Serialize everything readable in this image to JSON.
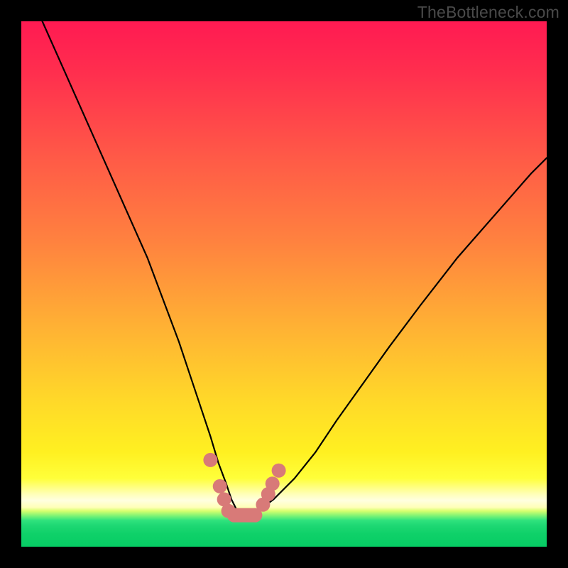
{
  "watermark": "TheBottleneck.com",
  "colors": {
    "gradient_top": "#ff1a52",
    "gradient_mid": "#ffd829",
    "gradient_band": "#ffffe0",
    "gradient_green": "#06cc64",
    "curve": "#000000",
    "markers": "#d87a78",
    "frame": "#000000"
  },
  "chart_data": {
    "type": "line",
    "title": "",
    "xlabel": "",
    "ylabel": "",
    "xlim": [
      0,
      100
    ],
    "ylim": [
      0,
      100
    ],
    "legend": false,
    "grid": false,
    "series": [
      {
        "name": "bottleneck-curve",
        "x": [
          4,
          8,
          12,
          16,
          20,
          24,
          27,
          30,
          32,
          34,
          36,
          37.5,
          39,
          40,
          41,
          42,
          43,
          44,
          46,
          48,
          52,
          56,
          60,
          65,
          70,
          76,
          83,
          90,
          97,
          100
        ],
        "y": [
          100,
          91,
          82,
          73,
          64,
          55,
          47,
          39,
          33,
          27,
          21,
          16,
          12,
          9,
          7,
          6,
          6,
          6.5,
          7.5,
          9,
          13,
          18,
          24,
          31,
          38,
          46,
          55,
          63,
          71,
          74
        ]
      }
    ],
    "markers": {
      "name": "highlighted-points",
      "note": "pink dots near the valley of the curve",
      "points": [
        {
          "x": 36.0,
          "y": 16.5
        },
        {
          "x": 37.8,
          "y": 11.5
        },
        {
          "x": 38.6,
          "y": 9.0
        },
        {
          "x": 39.4,
          "y": 6.8
        },
        {
          "x": 40.5,
          "y": 6.0
        },
        {
          "x": 41.5,
          "y": 6.0
        },
        {
          "x": 42.5,
          "y": 6.0
        },
        {
          "x": 43.5,
          "y": 6.0
        },
        {
          "x": 44.5,
          "y": 6.0
        },
        {
          "x": 46.0,
          "y": 8.0
        },
        {
          "x": 47.0,
          "y": 10.0
        },
        {
          "x": 47.8,
          "y": 12.0
        },
        {
          "x": 49.0,
          "y": 14.5
        }
      ]
    }
  }
}
